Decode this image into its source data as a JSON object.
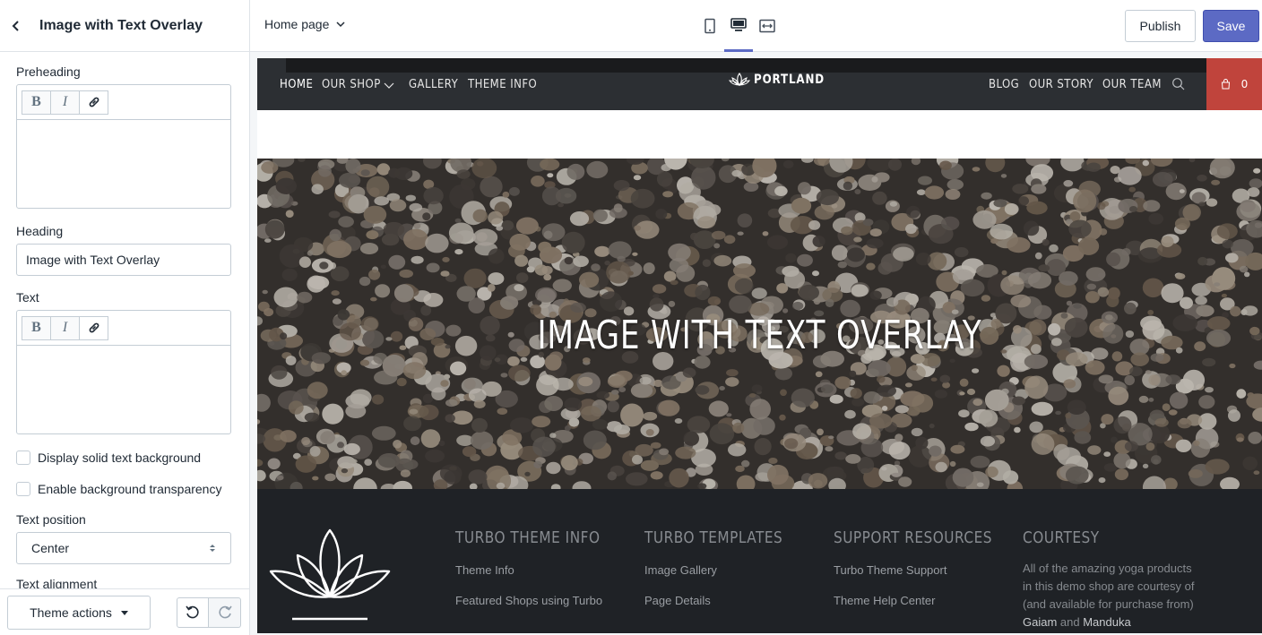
{
  "sidebar": {
    "title": "Image with Text Overlay",
    "preheading": {
      "label": "Preheading"
    },
    "heading": {
      "label": "Heading",
      "value": "Image with Text Overlay"
    },
    "text": {
      "label": "Text"
    },
    "rte_buttons": {
      "bold": "B",
      "italic": "I"
    },
    "display_solid_bg": "Display solid text background",
    "enable_transparency": "Enable background transparency",
    "text_position": {
      "label": "Text position",
      "value": "Center"
    },
    "text_alignment": {
      "label": "Text alignment"
    },
    "theme_actions": "Theme actions"
  },
  "topbar": {
    "page": "Home page",
    "devices": [
      "mobile-icon",
      "desktop-icon",
      "fullscreen-icon"
    ],
    "active_device": "desktop",
    "publish": "Publish",
    "save": "Save"
  },
  "site": {
    "nav_left": [
      "HOME",
      "OUR SHOP",
      "GALLERY",
      "THEME INFO"
    ],
    "logo": "PORTLAND",
    "nav_right": [
      "BLOG",
      "OUR STORY",
      "OUR TEAM"
    ],
    "cart_count": "0",
    "hero_title": "IMAGE WITH TEXT OVERLAY",
    "footer": {
      "col1": {
        "title": "TURBO THEME INFO",
        "links": [
          "Theme Info",
          "Featured Shops using Turbo"
        ]
      },
      "col2": {
        "title": "TURBO TEMPLATES",
        "links": [
          "Image Gallery",
          "Page Details"
        ]
      },
      "col3": {
        "title": "SUPPORT RESOURCES",
        "links": [
          "Turbo Theme Support",
          "Theme Help Center"
        ]
      },
      "col4": {
        "title": "COURTESY",
        "text_start": "All of the amazing yoga products in this demo shop are courtesy of (and available for purchase from) ",
        "brand1": "Gaiam",
        "and": " and ",
        "brand2": "Manduka"
      }
    }
  },
  "colors": {
    "accent": "#5c6ac4",
    "nav_bg": "#2c2f33",
    "cart_bg": "#c0443c",
    "footer_bg": "#1f2226"
  }
}
